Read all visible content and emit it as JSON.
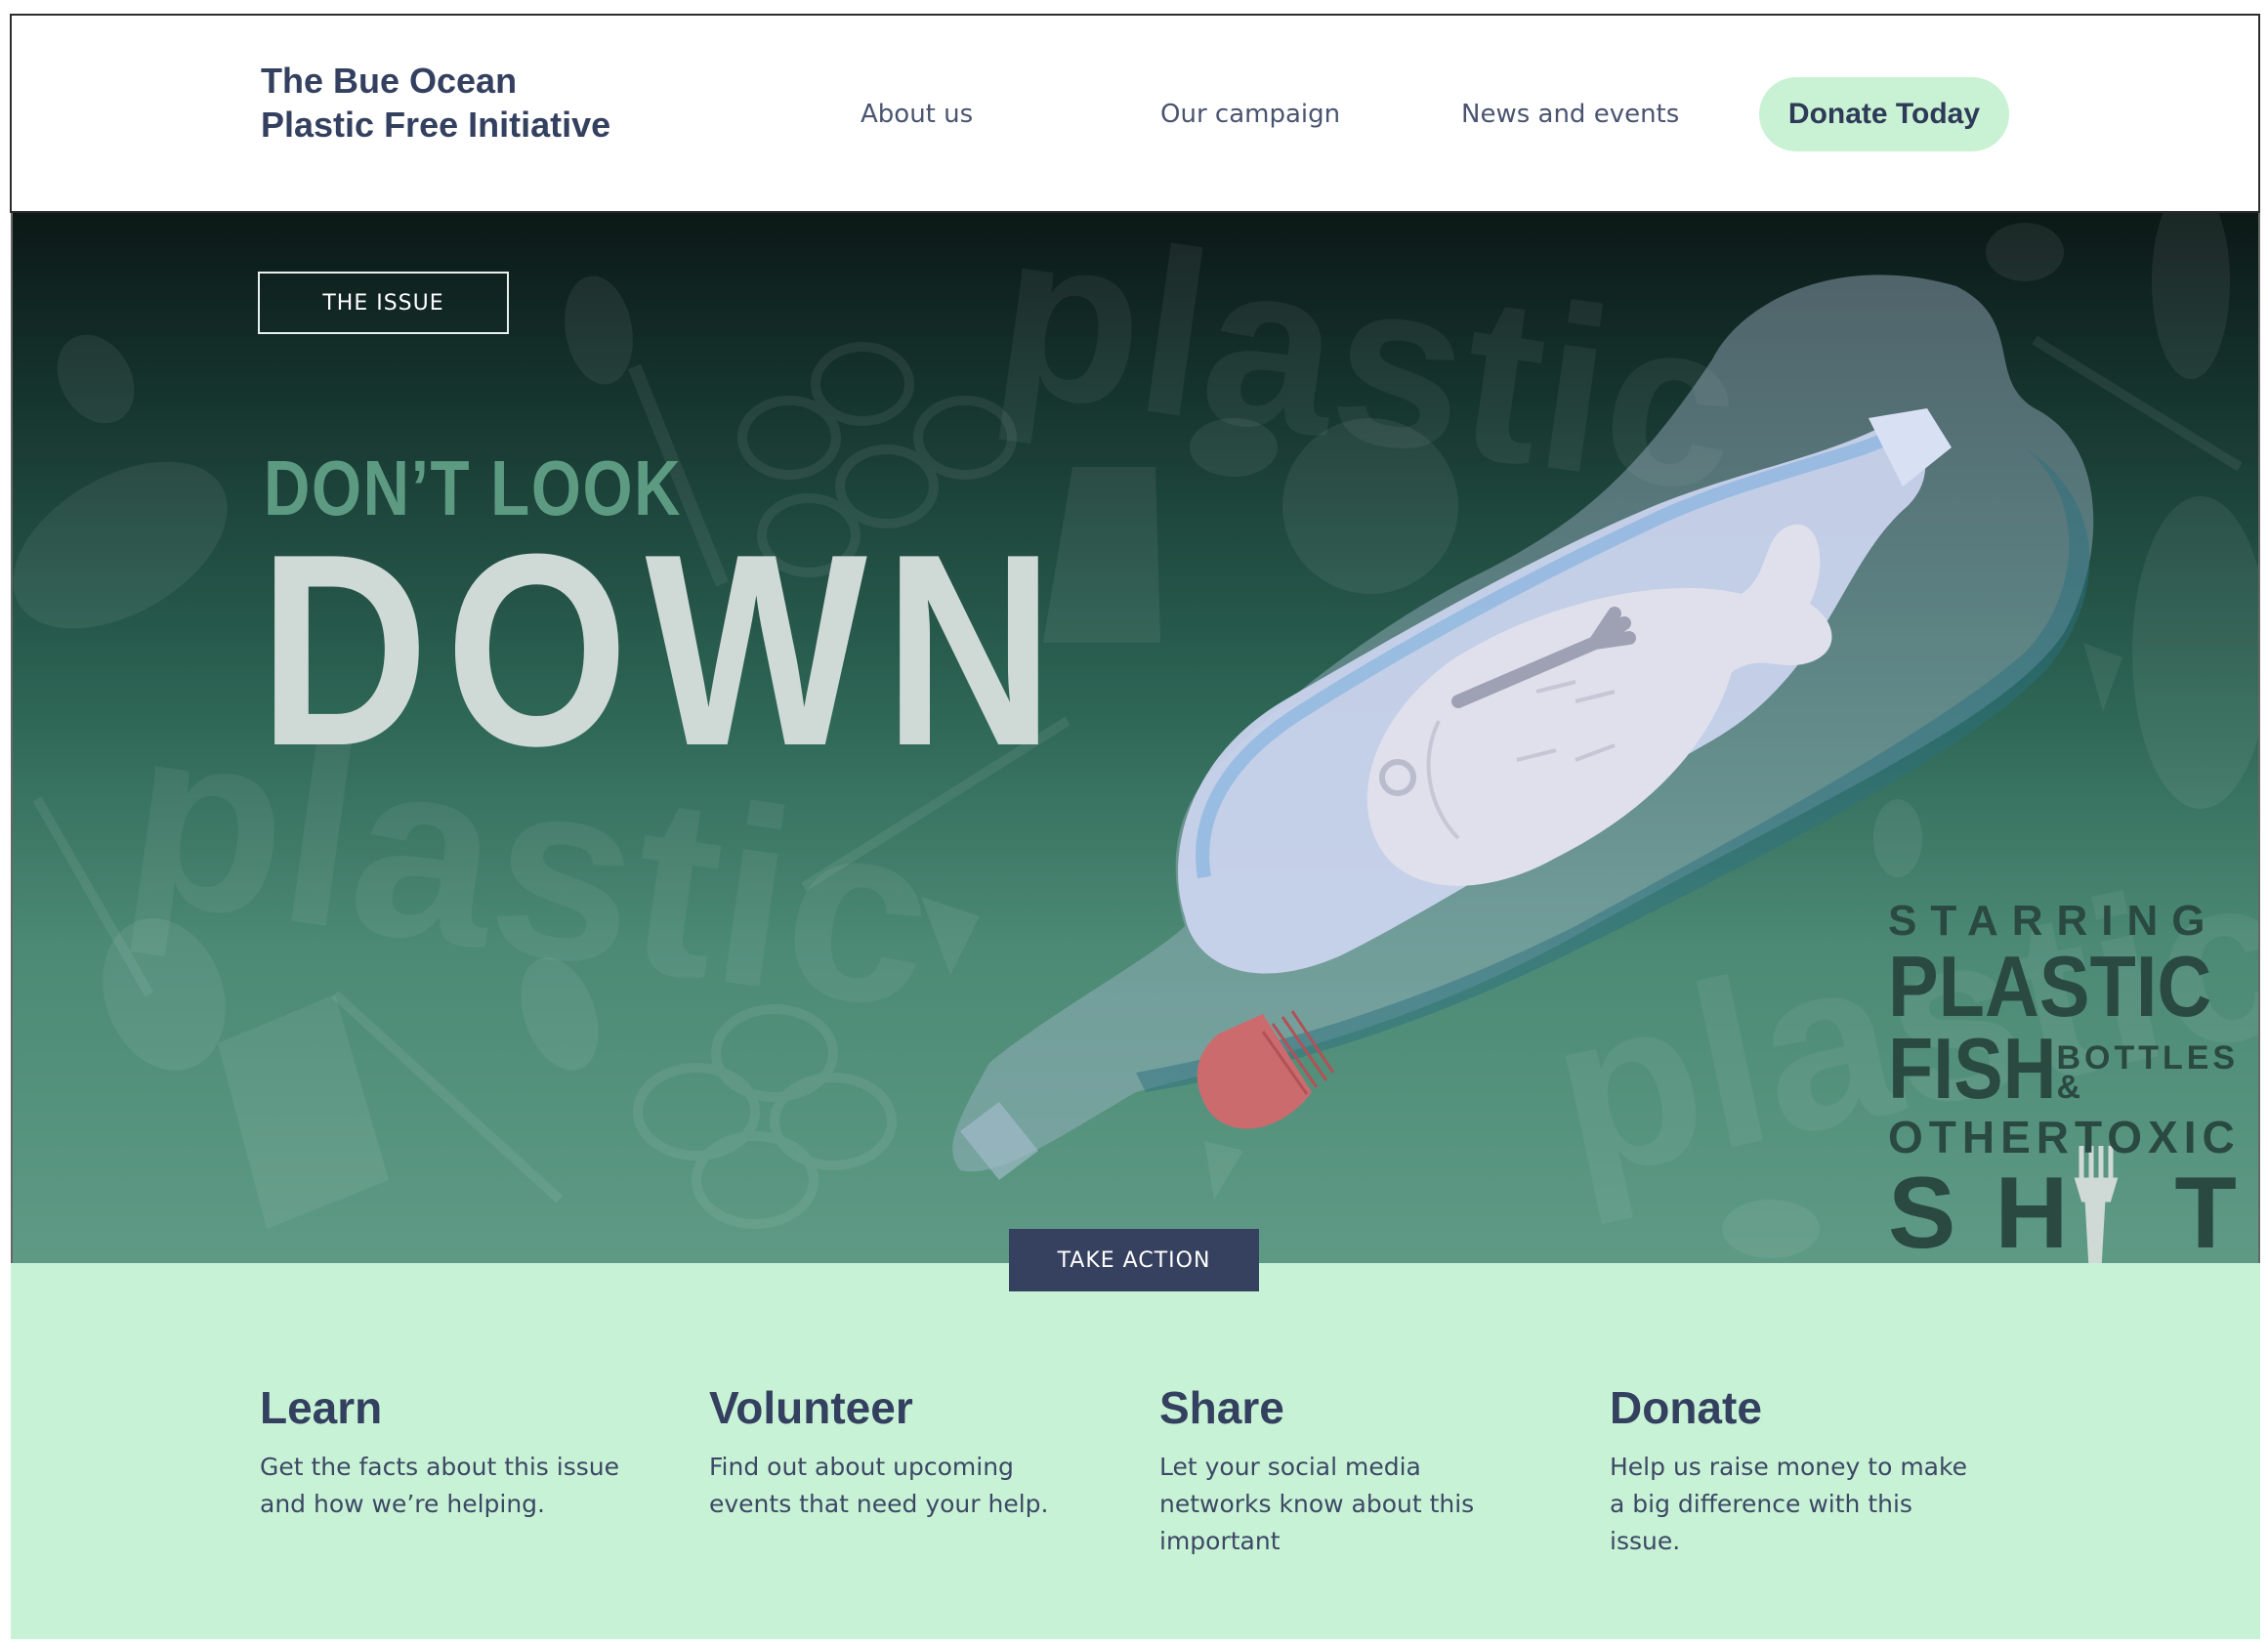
{
  "header": {
    "brand_line1": "The Bue Ocean",
    "brand_line2": "Plastic Free Initiative",
    "nav": [
      {
        "label": "About us"
      },
      {
        "label": "Our campaign"
      },
      {
        "label": "News and events"
      }
    ],
    "donate_label": "Donate Today"
  },
  "hero": {
    "tag": "THE ISSUE",
    "headline_small": "DON’T LOOK",
    "headline_big": "DOWN",
    "poster": {
      "line1": "STARRING",
      "line2": "PLASTIC",
      "line3": "FISH",
      "line3_top": "BOTTLES",
      "line3_bottom": "&",
      "line4": "OTHERTOXIC",
      "line5": "SH T"
    },
    "watermark": "plastic",
    "cta_label": "TAKE ACTION"
  },
  "actions": [
    {
      "title": "Learn",
      "text": "Get the facts about this issue and how we’re helping."
    },
    {
      "title": "Volunteer",
      "text": "Find out about upcoming events that need your help."
    },
    {
      "title": "Share",
      "text": "Let your social media networks know about this important"
    },
    {
      "title": "Donate",
      "text": "Help us raise money to make a big difference with this issue."
    }
  ],
  "colors": {
    "navy": "#34405f",
    "mint": "#c8f2d5",
    "hero_dark": "#0b1816",
    "hero_light": "#5e9a85",
    "cap_red": "#cc6b6e"
  }
}
